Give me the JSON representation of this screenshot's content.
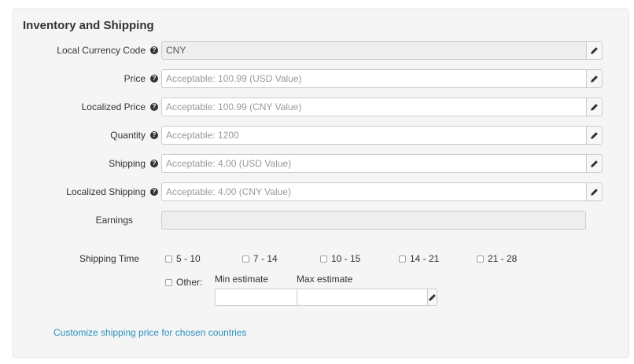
{
  "panel": {
    "title": "Inventory and Shipping"
  },
  "fields": [
    {
      "label": "Local Currency Code",
      "value": "CNY",
      "placeholder": ""
    },
    {
      "label": "Price",
      "value": "",
      "placeholder": "Acceptable: 100.99 (USD Value)"
    },
    {
      "label": "Localized Price",
      "value": "",
      "placeholder": "Acceptable: 100.99 (CNY Value)"
    },
    {
      "label": "Quantity",
      "value": "",
      "placeholder": "Acceptable: 1200"
    },
    {
      "label": "Shipping",
      "value": "",
      "placeholder": "Acceptable: 4.00 (USD Value)"
    },
    {
      "label": "Localized Shipping",
      "value": "",
      "placeholder": "Acceptable: 4.00 (CNY Value)"
    }
  ],
  "earnings": {
    "label": "Earnings",
    "value": ""
  },
  "shipping_time": {
    "label": "Shipping Time",
    "options": [
      "5 - 10",
      "7 - 14",
      "10 - 15",
      "14 - 21",
      "21 - 28"
    ],
    "other_label": "Other:",
    "min_label": "Min estimate",
    "max_label": "Max estimate",
    "min_value": "",
    "max_value": ""
  },
  "link": {
    "label": "Customize shipping price for chosen countries"
  },
  "icons": {
    "help": "question-circle-icon",
    "edit": "pencil-icon"
  },
  "colors": {
    "link": "#2a8fbd",
    "panel_bg": "#f5f5f5"
  }
}
